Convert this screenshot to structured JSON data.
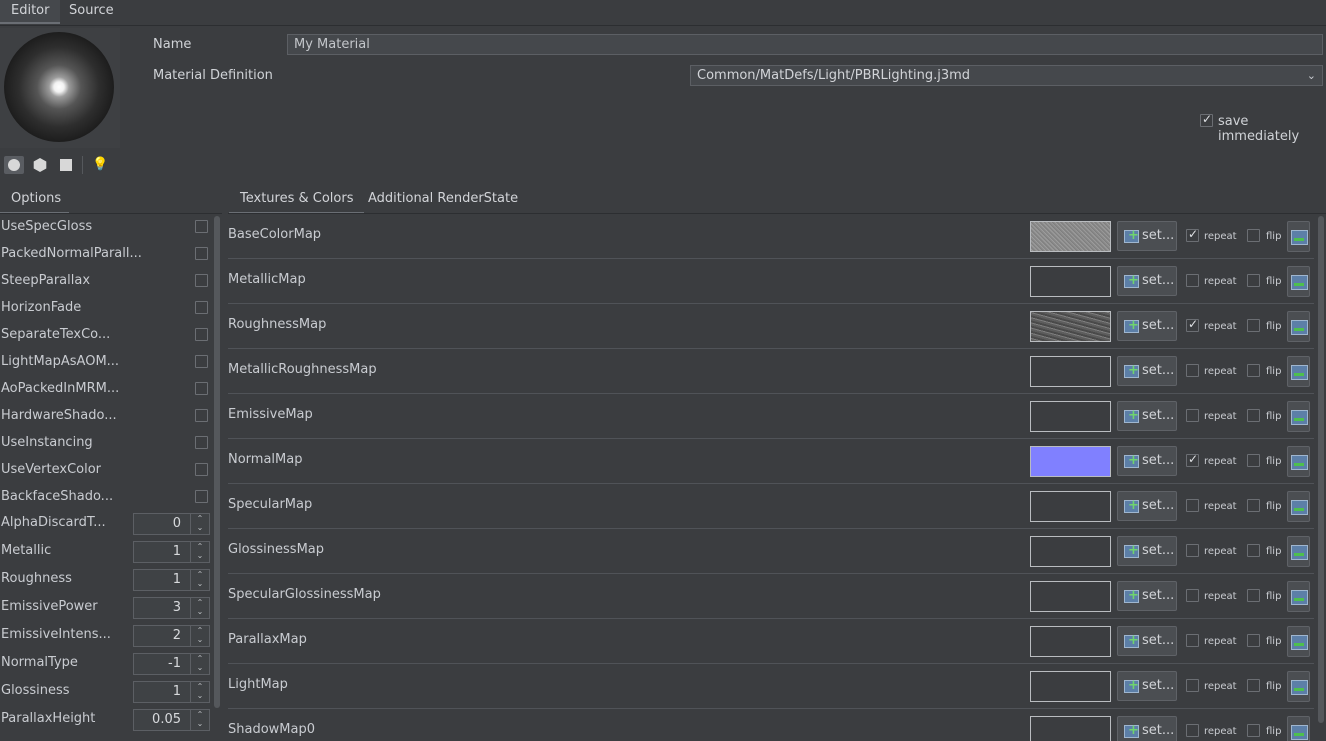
{
  "top_tabs": [
    {
      "label": "Editor"
    },
    {
      "label": "Source"
    }
  ],
  "name_label": "Name",
  "name_value": "My Material",
  "matdef_label": "Material Definition",
  "matdef_value": "Common/MatDefs/Light/PBRLighting.j3md",
  "save_immediately": {
    "label": "save immediately",
    "checked": true
  },
  "preview_tools": [
    {
      "icon": "sphere-icon",
      "active": true
    },
    {
      "icon": "cube-icon",
      "active": false
    },
    {
      "icon": "quad-icon",
      "active": false
    },
    {
      "icon": "light-bulb-icon",
      "active": false
    }
  ],
  "options_tab": "Options",
  "options": [
    {
      "label": "UseSpecGloss",
      "type": "bool",
      "checked": false
    },
    {
      "label": "PackedNormalParall...",
      "type": "bool",
      "checked": false
    },
    {
      "label": "SteepParallax",
      "type": "bool",
      "checked": false
    },
    {
      "label": "HorizonFade",
      "type": "bool",
      "checked": false
    },
    {
      "label": "SeparateTexCo...",
      "type": "bool",
      "checked": false
    },
    {
      "label": "LightMapAsAOM...",
      "type": "bool",
      "checked": false
    },
    {
      "label": "AoPackedInMRM...",
      "type": "bool",
      "checked": false
    },
    {
      "label": "HardwareShado...",
      "type": "bool",
      "checked": false
    },
    {
      "label": "UseInstancing",
      "type": "bool",
      "checked": false
    },
    {
      "label": "UseVertexColor",
      "type": "bool",
      "checked": false
    },
    {
      "label": "BackfaceShado...",
      "type": "bool",
      "checked": false
    },
    {
      "label": "AlphaDiscardT...",
      "type": "number",
      "value": "0"
    },
    {
      "label": "Metallic",
      "type": "number",
      "value": "1"
    },
    {
      "label": "Roughness",
      "type": "number",
      "value": "1"
    },
    {
      "label": "EmissivePower",
      "type": "number",
      "value": "3"
    },
    {
      "label": "EmissiveIntens...",
      "type": "number",
      "value": "2"
    },
    {
      "label": "NormalType",
      "type": "number",
      "value": "-1"
    },
    {
      "label": "Glossiness",
      "type": "number",
      "value": "1"
    },
    {
      "label": "ParallaxHeight",
      "type": "number",
      "value": "0.05"
    }
  ],
  "texture_tabs": [
    {
      "label": "Textures & Colors"
    },
    {
      "label": "Additional RenderState"
    }
  ],
  "textures": [
    {
      "label": "BaseColorMap",
      "thumb": "noise",
      "repeat": true,
      "flip": false
    },
    {
      "label": "MetallicMap",
      "thumb": "empty",
      "repeat": false,
      "flip": false
    },
    {
      "label": "RoughnessMap",
      "thumb": "rough",
      "repeat": true,
      "flip": false
    },
    {
      "label": "MetallicRoughnessMap",
      "thumb": "empty",
      "repeat": false,
      "flip": false
    },
    {
      "label": "EmissiveMap",
      "thumb": "empty",
      "repeat": false,
      "flip": false
    },
    {
      "label": "NormalMap",
      "thumb": "normal",
      "repeat": true,
      "flip": false
    },
    {
      "label": "SpecularMap",
      "thumb": "empty",
      "repeat": false,
      "flip": false
    },
    {
      "label": "GlossinessMap",
      "thumb": "empty",
      "repeat": false,
      "flip": false
    },
    {
      "label": "SpecularGlossinessMap",
      "thumb": "empty",
      "repeat": false,
      "flip": false
    },
    {
      "label": "ParallaxMap",
      "thumb": "empty",
      "repeat": false,
      "flip": false
    },
    {
      "label": "LightMap",
      "thumb": "empty",
      "repeat": false,
      "flip": false
    },
    {
      "label": "ShadowMap0",
      "thumb": "empty",
      "repeat": false,
      "flip": false
    }
  ],
  "set_button_label": "set...",
  "repeat_label": "repeat",
  "flip_label": "flip"
}
